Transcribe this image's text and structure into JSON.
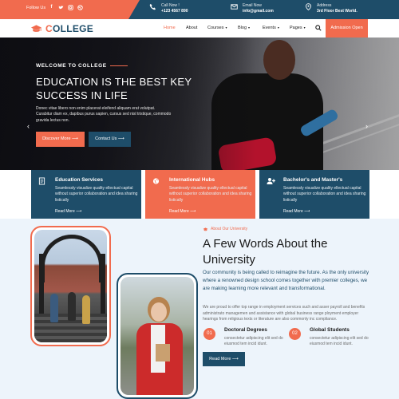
{
  "topbar": {
    "follow_label": "Follow Us",
    "socials": [
      "f",
      "t",
      "ig",
      "db"
    ],
    "call": {
      "label": "Call Now !",
      "value": "+123 4567 890"
    },
    "email": {
      "label": "Email Now",
      "value": "info@gmail.com"
    },
    "address": {
      "label": "Address",
      "value": "3rd Floor Best World."
    }
  },
  "brand": {
    "initial": "C",
    "rest": "OLLEGE"
  },
  "nav": {
    "items": [
      {
        "label": "Home",
        "active": true,
        "caret": false
      },
      {
        "label": "About",
        "active": false,
        "caret": false
      },
      {
        "label": "Courses",
        "active": false,
        "caret": true
      },
      {
        "label": "Blog",
        "active": false,
        "caret": true
      },
      {
        "label": "Events",
        "active": false,
        "caret": true
      },
      {
        "label": "Pages",
        "active": false,
        "caret": true
      }
    ],
    "caret_glyph": "▾",
    "admission_label": "Admission Open"
  },
  "hero": {
    "welcome": "WELCOME TO COLLEGE",
    "title": "EDUCATION IS THE BEST KEY SUCCESS IN LIFE",
    "desc": "Donec vitae libero non enim placerat eleifend aliquam erat volutpat. Curabitur diam ex, dapibus purus sapien, cursus sed nisl tristique, commodo gravida lectus non.",
    "discover_label": "Discover More",
    "contact_label": "Contact Us",
    "btn_arrow": "⟶"
  },
  "cards": [
    {
      "title": "Education Services",
      "desc": "Seamlessly visualize quality ellectual capital without superior collaboration and idea sharing listically",
      "more": "Read More",
      "icon": "book-icon"
    },
    {
      "title": "International Hubs",
      "desc": "Seamlessly visualize quality ellectual capital without superior collaboration and idea sharing listically",
      "more": "Read More",
      "icon": "globe-icon"
    },
    {
      "title": "Bachelor's and Master's",
      "desc": "Seamlessly visualize quality ellectual capital without superior collaboration and idea sharing listically",
      "more": "Read More",
      "icon": "users-icon"
    }
  ],
  "about": {
    "subtitle": "About Our University",
    "title": "A Few Words About the University",
    "lead": "Our community is being called to reimagine the future. As the only university where a renowned design school comes together with premier colleges, we are making learning more relevant and transformational.",
    "desc": "We are proud to offer top range in employment services such and asser payroll and benefits administrato managemen and assistance with global business range ployment employer hearings from religious texts or literature are also commonly inc compliance.",
    "features": [
      {
        "num": "01",
        "title": "Doctoral Degrees",
        "desc": "consectetur adipiscing elit sed do eiusmod tem incid idunt."
      },
      {
        "num": "02",
        "title": "Global Students",
        "desc": "consectetur adipiscing elit sed do eiusmod tem incid idunt."
      }
    ],
    "button_label": "Read More"
  },
  "colors": {
    "accent": "#f16b4e",
    "primary": "#1e4d69",
    "section_bg": "#edf4fb"
  }
}
